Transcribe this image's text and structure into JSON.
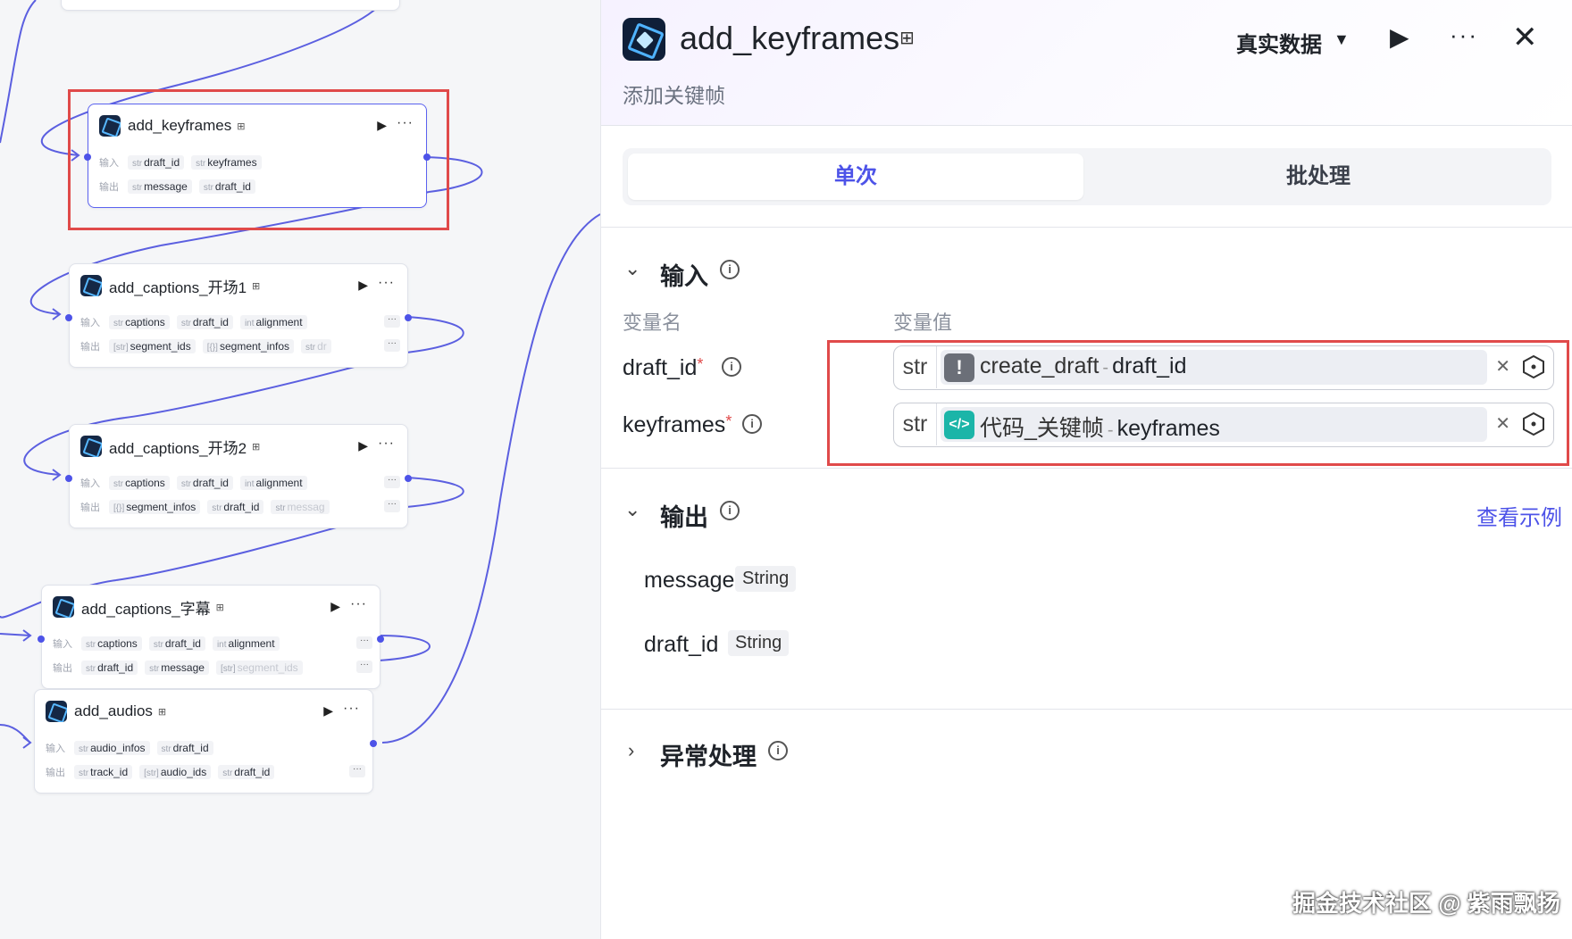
{
  "canvas": {
    "row_labels": {
      "input": "输入",
      "output": "输出"
    },
    "nodes": [
      {
        "title": "add_keyframes",
        "inputs": [
          {
            "type": "str",
            "name": "draft_id"
          },
          {
            "type": "str",
            "name": "keyframes"
          }
        ],
        "outputs": [
          {
            "type": "str",
            "name": "message"
          },
          {
            "type": "str",
            "name": "draft_id"
          }
        ]
      },
      {
        "title": "add_captions_开场1",
        "inputs": [
          {
            "type": "str",
            "name": "captions"
          },
          {
            "type": "str",
            "name": "draft_id"
          },
          {
            "type": "int",
            "name": "alignment"
          }
        ],
        "outputs": [
          {
            "type": "[str]",
            "name": "segment_ids"
          },
          {
            "type": "[{}]",
            "name": "segment_infos"
          },
          {
            "type": "str",
            "name": "dr"
          }
        ]
      },
      {
        "title": "add_captions_开场2",
        "inputs": [
          {
            "type": "str",
            "name": "captions"
          },
          {
            "type": "str",
            "name": "draft_id"
          },
          {
            "type": "int",
            "name": "alignment"
          }
        ],
        "outputs": [
          {
            "type": "[{}]",
            "name": "segment_infos"
          },
          {
            "type": "str",
            "name": "draft_id"
          },
          {
            "type": "str",
            "name": "messag"
          }
        ]
      },
      {
        "title": "add_captions_字幕",
        "inputs": [
          {
            "type": "str",
            "name": "captions"
          },
          {
            "type": "str",
            "name": "draft_id"
          },
          {
            "type": "int",
            "name": "alignment"
          }
        ],
        "outputs": [
          {
            "type": "str",
            "name": "draft_id"
          },
          {
            "type": "str",
            "name": "message"
          },
          {
            "type": "[str]",
            "name": "segment_ids"
          }
        ]
      },
      {
        "title": "add_audios",
        "inputs": [
          {
            "type": "str",
            "name": "audio_infos"
          },
          {
            "type": "str",
            "name": "draft_id"
          }
        ],
        "outputs": [
          {
            "type": "str",
            "name": "track_id"
          },
          {
            "type": "[str]",
            "name": "audio_ids"
          },
          {
            "type": "str",
            "name": "draft_id"
          }
        ]
      }
    ]
  },
  "panel": {
    "title": "add_keyframes",
    "subtitle": "添加关键帧",
    "mode": "真实数据",
    "tabs": {
      "single": "单次",
      "batch": "批处理"
    },
    "input": {
      "title": "输入",
      "col_name": "变量名",
      "col_value": "变量值",
      "fields": [
        {
          "name": "draft_id",
          "type": "str",
          "source": "create_draft",
          "sep": "-",
          "value": "draft_id"
        },
        {
          "name": "keyframes",
          "type": "str",
          "source": "代码_关键帧",
          "sep": "-",
          "value": "keyframes"
        }
      ]
    },
    "output": {
      "title": "输出",
      "example_link": "查看示例",
      "items": [
        {
          "name": "message",
          "type": "String"
        },
        {
          "name": "draft_id",
          "type": "String"
        }
      ]
    },
    "exception": {
      "title": "异常处理"
    }
  },
  "watermark": "掘金技术社区 @ 紫雨飘扬",
  "colors": {
    "accent": "#4d53e8",
    "highlight": "#e04a4a",
    "wire": "#5b5fe0"
  },
  "icons": {
    "node_logo": "app-logo-icon",
    "play": "play-icon",
    "more": "more-icon",
    "close": "close-icon",
    "info": "info-icon",
    "dropdown": "caret-down-icon",
    "collapse": "chevron-icon",
    "clear": "clear-icon",
    "variable": "variable-hex-icon",
    "warning": "warning-icon",
    "code": "code-icon"
  }
}
